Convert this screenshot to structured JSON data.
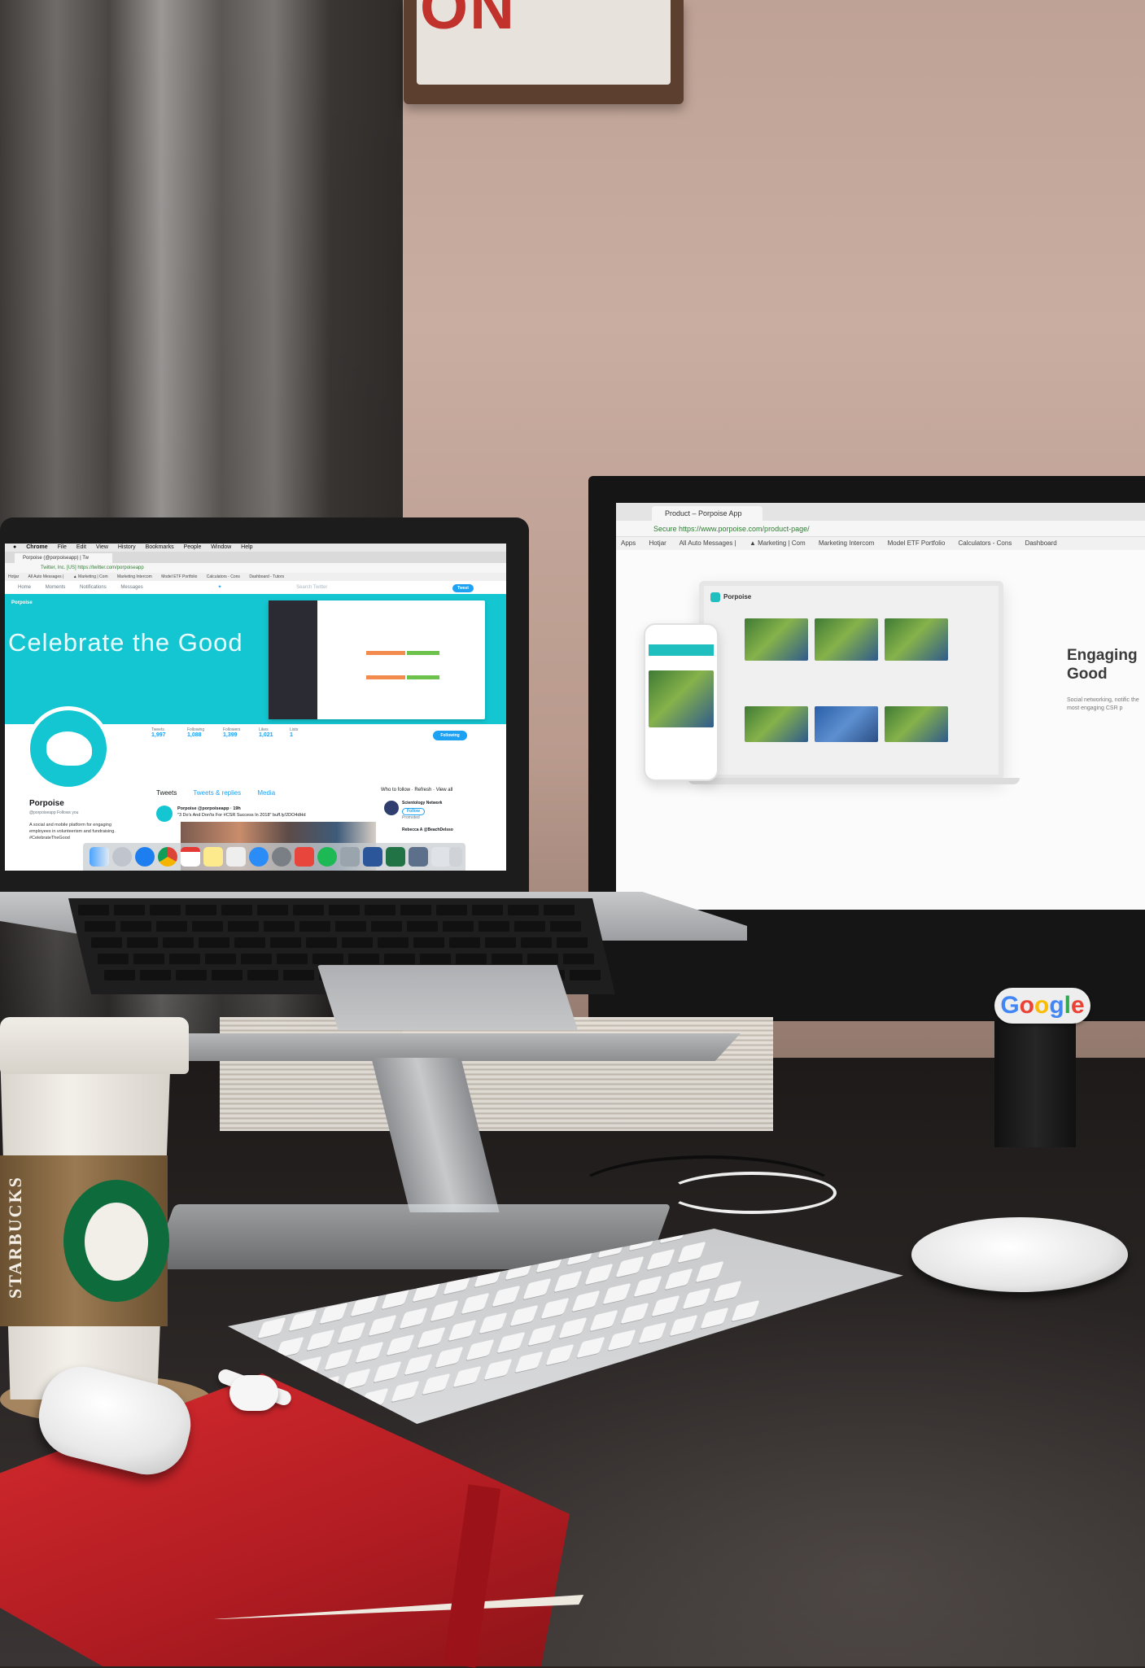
{
  "sign": {
    "text": "ON"
  },
  "laptop": {
    "menubar": [
      "Chrome",
      "File",
      "Edit",
      "View",
      "History",
      "Bookmarks",
      "People",
      "Window",
      "Help"
    ],
    "tab_title": "Porpoise (@porpoiseapp) | Tw",
    "url": "Twitter, Inc. [US]  https://twitter.com/porpoiseapp",
    "bookmarks": [
      "Hotjar",
      "All Auto Messages |",
      "▲ Marketing | Com",
      "Marketing Intercom",
      "Model ETF Portfolio",
      "Calculators - Cons",
      "Dashboard - Tutors"
    ],
    "twitter_nav": [
      "Home",
      "Moments",
      "Notifications",
      "Messages"
    ],
    "search_placeholder": "Search Twitter",
    "tweet_button": "Tweet",
    "banner_text": "Celebrate the Good",
    "stats": [
      {
        "label": "Tweets",
        "value": "1,997"
      },
      {
        "label": "Following",
        "value": "1,088"
      },
      {
        "label": "Followers",
        "value": "1,399"
      },
      {
        "label": "Likes",
        "value": "1,021"
      },
      {
        "label": "Lists",
        "value": "1"
      }
    ],
    "following_button": "Following",
    "profile_name": "Porpoise",
    "profile_handle": "@porpoiseapp  Follows you",
    "bio": "A social and mobile platform for engaging employees in volunteerism and fundraising. #CelebrateTheGood",
    "tabs": [
      "Tweets",
      "Tweets & replies",
      "Media"
    ],
    "tweet_author": "Porpoise @porpoiseapp · 19h",
    "tweet_text": "\"3 Do's And Don'ts For #CSR Success In 2018\" buff.ly/2DO4dHd",
    "who_to_follow": "Who to follow · Refresh · View all",
    "wtf_account": "Scientology Network",
    "wtf_follow": "Follow",
    "wtf_promoted": "Promoted",
    "wtf_second": "Rebecca A @BeachDelsso",
    "sticker_brand": "Porpoise"
  },
  "monitor": {
    "tab_title": "Product – Porpoise App",
    "url": "Secure  https://www.porpoise.com/product-page/",
    "bookmarks": [
      "Apps",
      "Hotjar",
      "All Auto Messages |",
      "▲ Marketing | Com",
      "Marketing Intercom",
      "Model ETF Portfolio",
      "Calculators - Cons",
      "Dashboard"
    ],
    "mock_brand": "Porpoise",
    "headline": "Engaging\nGood",
    "subtext": "Social networking, notific the most engaging CSR p"
  },
  "google_sticker": {
    "text": "Google",
    "letter_colors": [
      "#4285F4",
      "#EA4335",
      "#FBBC05",
      "#4285F4",
      "#34A853",
      "#EA4335"
    ]
  },
  "cup": {
    "brand": "STARBUCKS"
  }
}
